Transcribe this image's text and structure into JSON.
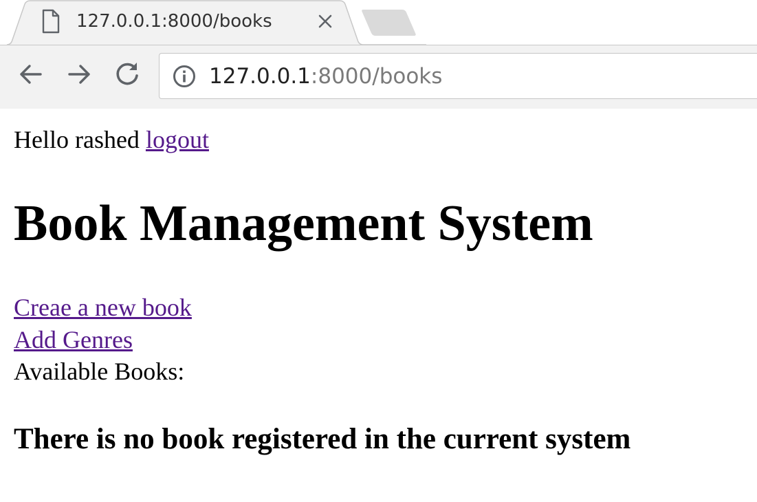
{
  "browser": {
    "tab": {
      "title": "127.0.0.1:8000/books",
      "file_icon": "page-icon",
      "close_icon": "close-icon"
    },
    "toolbar": {
      "back_icon": "arrow-left-icon",
      "forward_icon": "arrow-right-icon",
      "reload_icon": "reload-icon",
      "info_icon": "info-icon"
    },
    "address_bar": {
      "host": "127.0.0.1",
      "rest": ":8000/books"
    }
  },
  "page": {
    "greeting": {
      "text": "Hello rashed",
      "logout_label": "logout"
    },
    "title": "Book Management System",
    "links": {
      "create_book": "Creae a new book",
      "add_genres": "Add Genres"
    },
    "available_label": "Available Books:",
    "empty_message": "There is no book registered in the current system"
  },
  "colors": {
    "visited_link": "#551a8b",
    "chrome_bg": "#f2f2f2",
    "url_path": "#7a7a7a"
  }
}
